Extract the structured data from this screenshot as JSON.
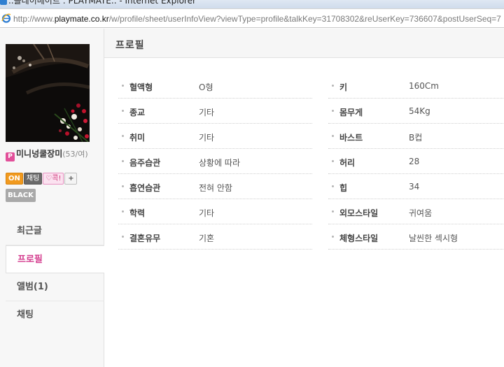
{
  "window": {
    "title": "..플레이메이트 : PLAYMATE.. - Internet Explorer",
    "url_prefix": "http://www.",
    "url_host": "playmate.co.kr",
    "url_path": "/w/profile/sheet/userInfoView?viewType=profile&talkKey=31708302&reUserKey=736607&postUserSeq=7"
  },
  "sidebar": {
    "badge_p": "P",
    "nickname": "미니넝쿨장미",
    "age_gender": "(53/여)",
    "badges": {
      "on": "ON",
      "chat": "채팅",
      "poke": "♡콕!",
      "plus": "+",
      "black": "BLACK"
    },
    "nav": [
      {
        "label": "최근글"
      },
      {
        "label": "프로필"
      },
      {
        "label": "앨범(1)"
      },
      {
        "label": "채팅"
      }
    ]
  },
  "main": {
    "title": "프로필",
    "left_rows": [
      {
        "label": "혈액형",
        "value": "O형"
      },
      {
        "label": "종교",
        "value": "기타"
      },
      {
        "label": "취미",
        "value": "기타"
      },
      {
        "label": "음주습관",
        "value": "상황에 따라"
      },
      {
        "label": "흡연습관",
        "value": "전혀 안함"
      },
      {
        "label": "학력",
        "value": "기타"
      },
      {
        "label": "결혼유무",
        "value": "기혼"
      }
    ],
    "right_rows": [
      {
        "label": "키",
        "value": "160Cm"
      },
      {
        "label": "몸무게",
        "value": "54Kg"
      },
      {
        "label": "바스트",
        "value": "B컵"
      },
      {
        "label": "허리",
        "value": "28"
      },
      {
        "label": "힙",
        "value": "34"
      },
      {
        "label": "외모스타일",
        "value": "귀여움"
      },
      {
        "label": "체형스타일",
        "value": "날씬한 섹시형"
      }
    ]
  },
  "colors": {
    "accent_pink": "#d43c8e",
    "on_badge": "#f19a1f"
  }
}
